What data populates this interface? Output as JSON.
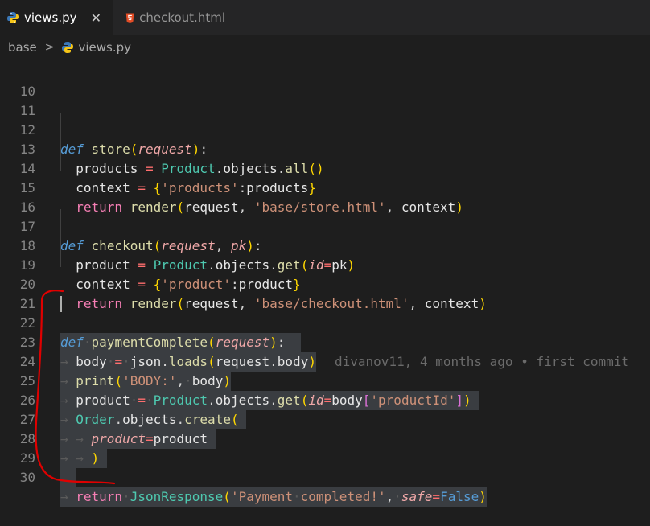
{
  "tabs": [
    {
      "label": "views.py",
      "active": true,
      "icon": "python-icon"
    },
    {
      "label": "checkout.html",
      "active": false,
      "icon": "html5-icon"
    }
  ],
  "tab_close": "✕",
  "breadcrumb": {
    "folder": "base",
    "separator": ">",
    "file": "views.py"
  },
  "blame": "divanov11, 4 months ago • first commit",
  "lines": {
    "10": "10",
    "11": "11",
    "12": "12",
    "13": "13",
    "14": "14",
    "15": "15",
    "16": "16",
    "17": "17",
    "18": "18",
    "19": "19",
    "20": "20",
    "21": "21",
    "22": "22",
    "23": "23",
    "24": "24",
    "25": "25",
    "26": "26",
    "27": "27",
    "28": "28",
    "29": "29",
    "30": "30"
  },
  "colors": {
    "background": "#1e1e1e",
    "keyword": "#569cd6",
    "function": "#dcdcaa",
    "string": "#ce9178",
    "annotation": "#e00000"
  }
}
